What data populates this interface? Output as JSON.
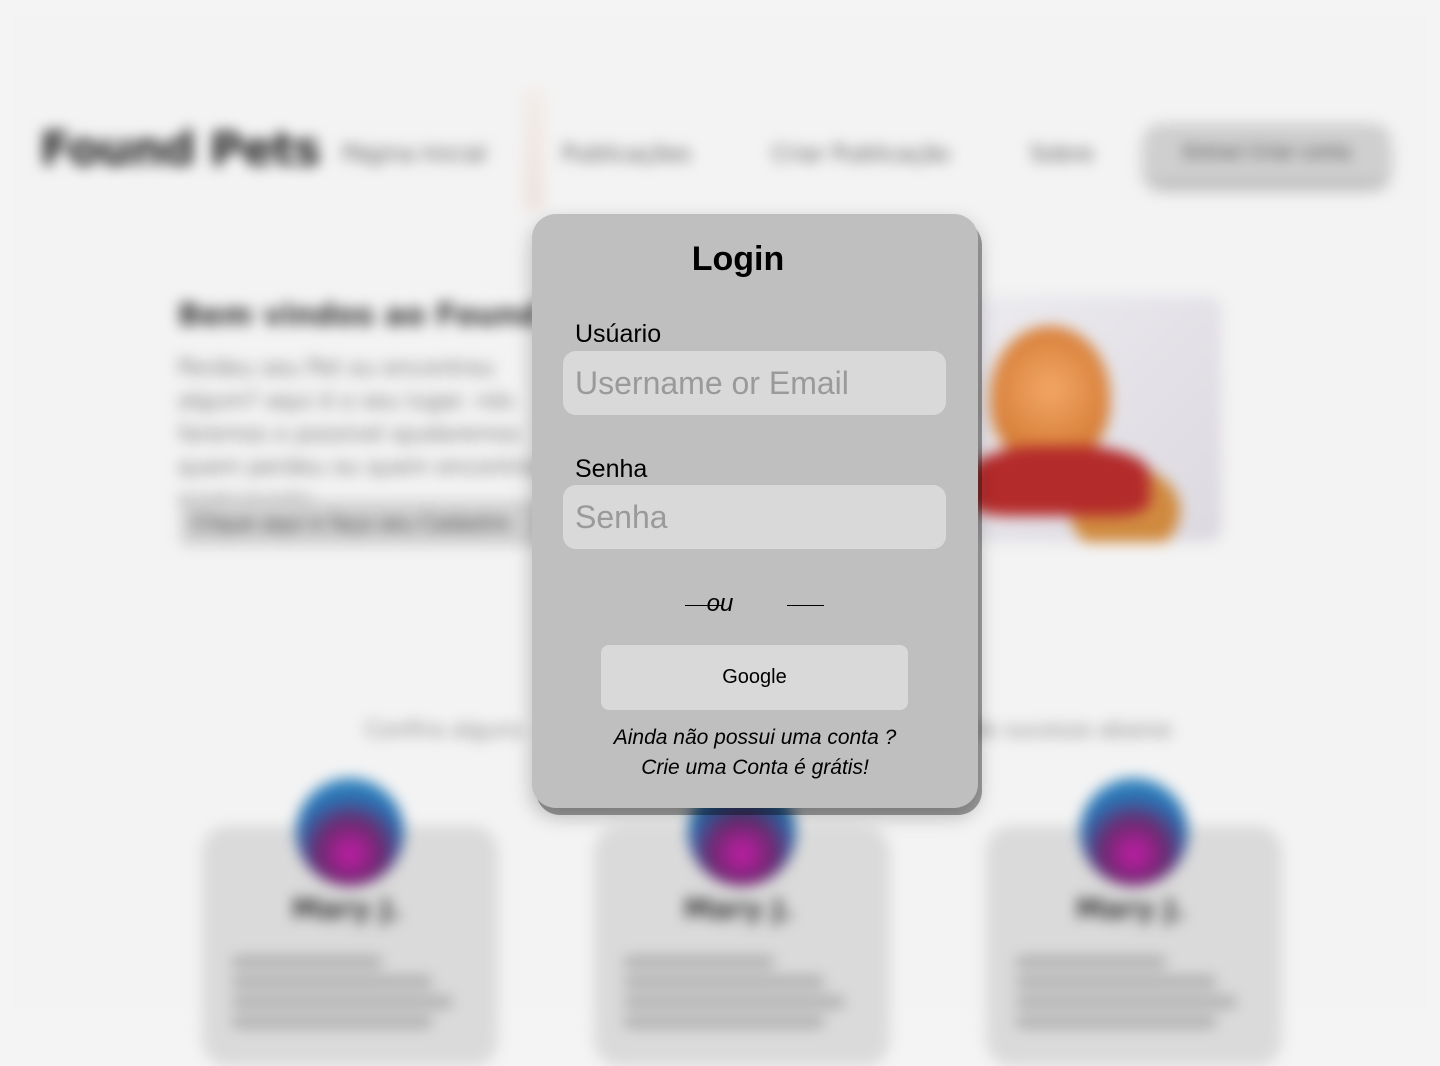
{
  "background": {
    "logo": "Found Pets",
    "nav": [
      "Página Inicial",
      "Publicações",
      "Criar Publicação",
      "Sobre"
    ],
    "nav_button": "Entrar/ Criar conta",
    "hero_title": "Bem vindos ao Found Pets",
    "hero_text": "Perdeu seu Pet ou encontrou algum? aqui é o seu lugar. nós faremos o possível ajudaremos quem perdeu ou quem encontrou permanente.",
    "hero_button": "Clique aqui e faça seu Cadastro",
    "section_text_left": "Confira alguns",
    "section_text_right": "de sucesso abaixo",
    "cards": [
      {
        "name": "Mary J."
      },
      {
        "name": "Mary J."
      },
      {
        "name": "Mary J."
      }
    ]
  },
  "login": {
    "title": "Login",
    "user_label": "Usúario",
    "user_placeholder": "Username or Email",
    "password_label": "Senha",
    "password_placeholder": "Senha",
    "or_text": "ou",
    "google_label": "Google",
    "signup_line1": "Ainda não possui uma conta ?",
    "signup_line2": "Crie uma  Conta é grátis!"
  },
  "colors": {
    "modal_bg": "#bfbfbf",
    "input_bg": "#d9d9d9",
    "page_bg": "#f3f3f3"
  }
}
